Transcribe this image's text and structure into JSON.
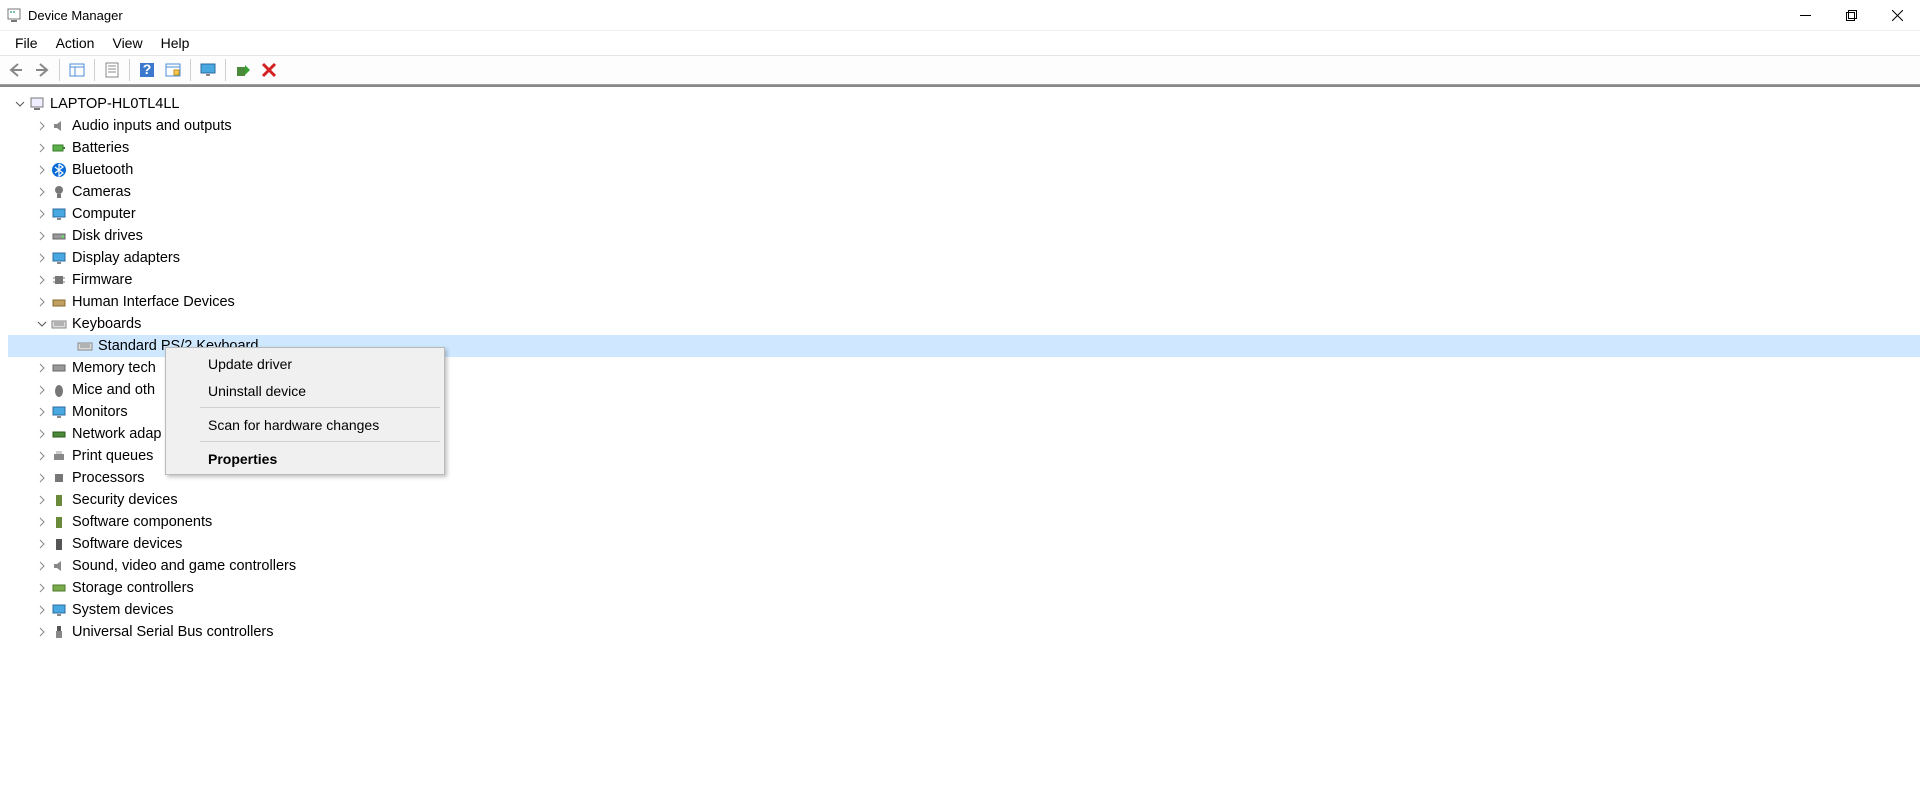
{
  "window": {
    "title": "Device Manager"
  },
  "menubar": [
    "File",
    "Action",
    "View",
    "Help"
  ],
  "tree": {
    "root": "LAPTOP-HL0TL4LL",
    "nodes": [
      "Audio inputs and outputs",
      "Batteries",
      "Bluetooth",
      "Cameras",
      "Computer",
      "Disk drives",
      "Display adapters",
      "Firmware",
      "Human Interface Devices",
      "Keyboards",
      "Memory tech",
      "Mice and oth",
      "Monitors",
      "Network adap",
      "Print queues",
      "Processors",
      "Security devices",
      "Software components",
      "Software devices",
      "Sound, video and game controllers",
      "Storage controllers",
      "System devices",
      "Universal Serial Bus controllers"
    ],
    "keyboard_child": "Standard PS/2 Keyboard"
  },
  "context_menu": {
    "update": "Update driver",
    "uninstall": "Uninstall device",
    "scan": "Scan for hardware changes",
    "properties": "Properties"
  }
}
